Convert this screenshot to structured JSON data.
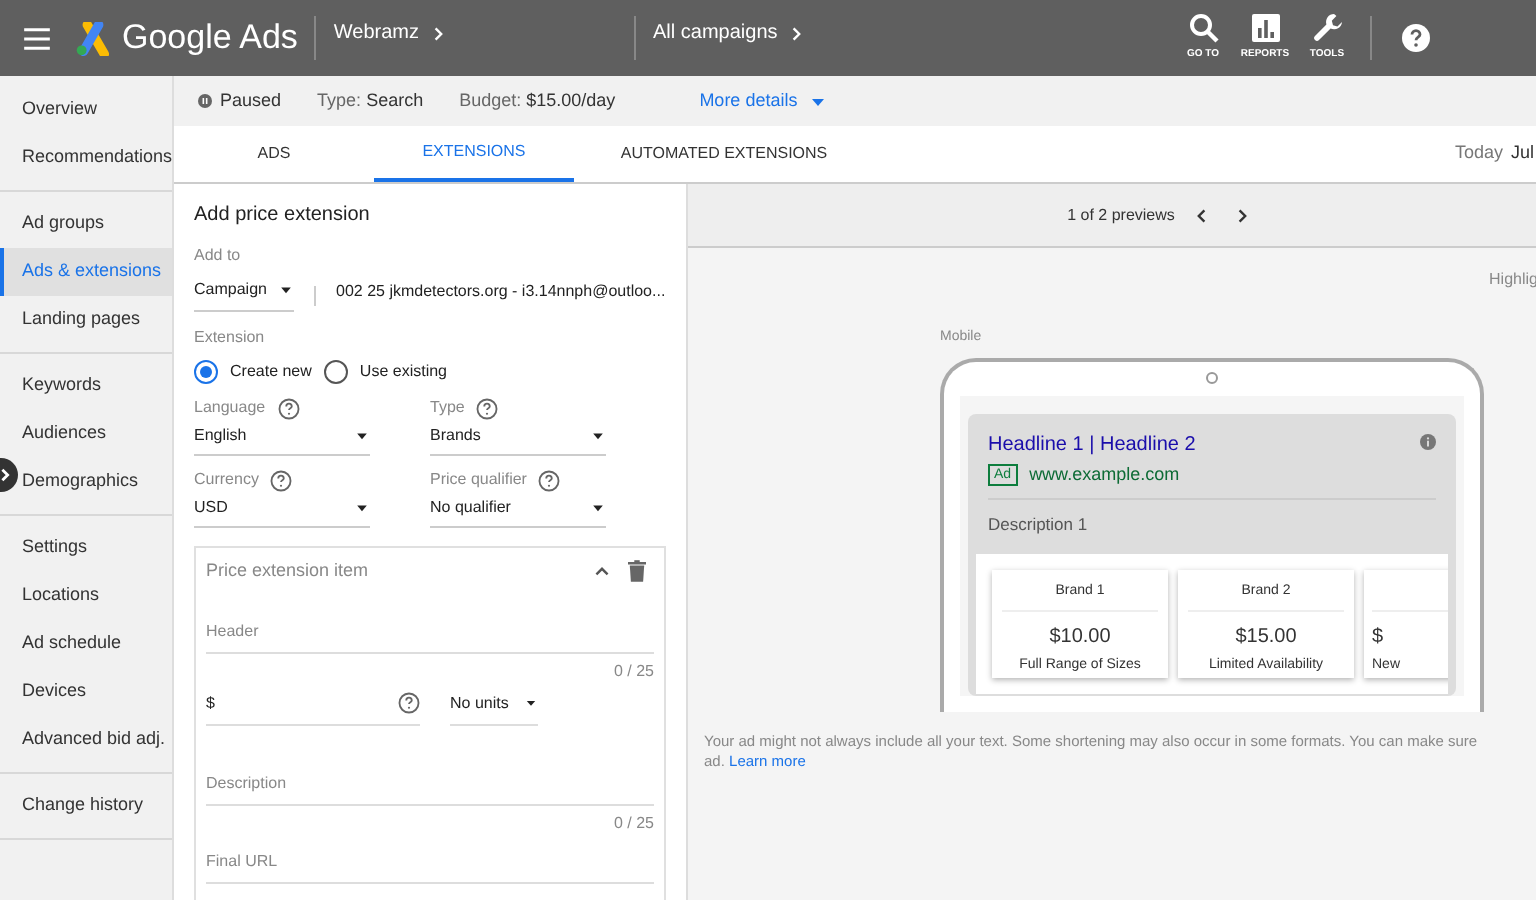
{
  "header": {
    "brand": "Google Ads",
    "account": "Webramz",
    "scope": "All campaigns",
    "tools": [
      {
        "kind": "search",
        "label": "GO TO"
      },
      {
        "kind": "reports",
        "label": "REPORTS"
      },
      {
        "kind": "tools",
        "label": "TOOLS"
      }
    ]
  },
  "sidebar": {
    "groups": [
      [
        {
          "label": "Overview",
          "selected": false
        },
        {
          "label": "Recommendations",
          "selected": false
        }
      ],
      [
        {
          "label": "Ad groups",
          "selected": false
        },
        {
          "label": "Ads & extensions",
          "selected": true
        },
        {
          "label": "Landing pages",
          "selected": false
        }
      ],
      [
        {
          "label": "Keywords",
          "selected": false
        },
        {
          "label": "Audiences",
          "selected": false
        },
        {
          "label": "Demographics",
          "selected": false
        }
      ],
      [
        {
          "label": "Settings",
          "selected": false
        },
        {
          "label": "Locations",
          "selected": false
        },
        {
          "label": "Ad schedule",
          "selected": false
        },
        {
          "label": "Devices",
          "selected": false
        },
        {
          "label": "Advanced bid adj.",
          "selected": false
        }
      ],
      [
        {
          "label": "Change history",
          "selected": false
        }
      ]
    ]
  },
  "status_bar": {
    "status": "Paused",
    "type_label": "Type:",
    "type": "Search",
    "budget_label": "Budget:",
    "budget": "$15.00/day",
    "more": "More details"
  },
  "tabs": [
    {
      "label": "ADS",
      "selected": false
    },
    {
      "label": "EXTENSIONS",
      "selected": true
    },
    {
      "label": "AUTOMATED EXTENSIONS",
      "selected": false
    }
  ],
  "date": {
    "label": "Today",
    "value": "Jul"
  },
  "form": {
    "title": "Add price extension",
    "add_to_label": "Add to",
    "add_to": "Campaign",
    "target": "002 25 jkmdetectors.org - i3.14nnph@outloo...",
    "extension_label": "Extension",
    "radios": [
      {
        "label": "Create new",
        "selected": true
      },
      {
        "label": "Use existing",
        "selected": false
      }
    ],
    "selects": [
      {
        "label": "Language",
        "value": "English"
      },
      {
        "label": "Type",
        "value": "Brands"
      },
      {
        "label": "Currency",
        "value": "USD"
      },
      {
        "label": "Price qualifier",
        "value": "No qualifier"
      }
    ],
    "item": {
      "title": "Price extension item",
      "header_placeholder": "Header",
      "header_count": "0 / 25",
      "price_prefix": "$",
      "units": "No units",
      "description_placeholder": "Description",
      "description_count": "0 / 25",
      "url_placeholder": "Final URL"
    }
  },
  "preview": {
    "pager": "1 of 2 previews",
    "highlight": "Highlig",
    "device": "Mobile",
    "headline": "Headline 1 | Headline 2",
    "ad_badge": "Ad",
    "url": "www.example.com",
    "description": "Description 1",
    "cards": [
      {
        "title": "Brand 1",
        "price": "$10.00",
        "desc": "Full Range of Sizes"
      },
      {
        "title": "Brand 2",
        "price": "$15.00",
        "desc": "Limited Availability"
      },
      {
        "price": "$",
        "desc": "New"
      }
    ],
    "note_lines": [
      "Your ad might not always include all your text. Some shortening may also occur in some formats. You can make sure",
      "ad."
    ],
    "learn_more": "Learn more"
  }
}
